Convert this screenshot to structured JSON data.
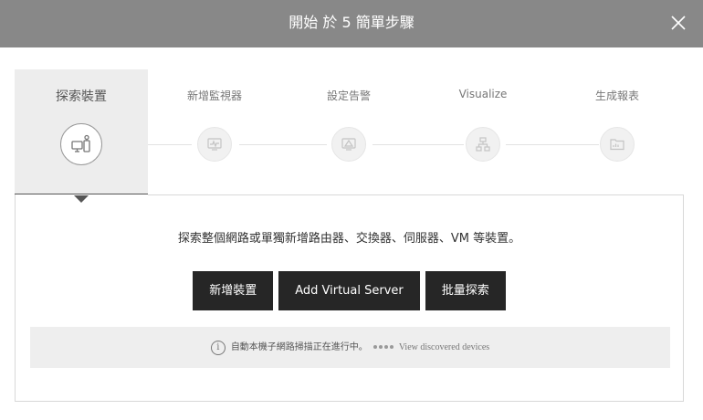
{
  "dialog": {
    "title": "開始 於 5 簡單步驟",
    "close_icon": "close-icon"
  },
  "steps": [
    {
      "label": "探索裝置",
      "icon": "device-discover-icon",
      "active": true
    },
    {
      "label": "新增監視器",
      "icon": "monitor-icon",
      "active": false
    },
    {
      "label": "設定告警",
      "icon": "alarm-icon",
      "active": false
    },
    {
      "label": "Visualize",
      "icon": "topology-icon",
      "active": false
    },
    {
      "label": "生成報表",
      "icon": "report-icon",
      "active": false
    }
  ],
  "panel": {
    "description": "探索整個網路或單獨新增路由器、交換器、伺服器、VM 等裝置。",
    "buttons": {
      "add_device": "新增裝置",
      "add_virtual_server": "Add Virtual Server",
      "bulk_discover": "批量探索"
    },
    "notice": {
      "icon": "info-icon",
      "text": "自動本機子網路掃描正在進行中。",
      "link": "View discovered devices"
    }
  },
  "colors": {
    "titlebar": "#888888",
    "button": "#262626",
    "active_step": "#ededed"
  }
}
